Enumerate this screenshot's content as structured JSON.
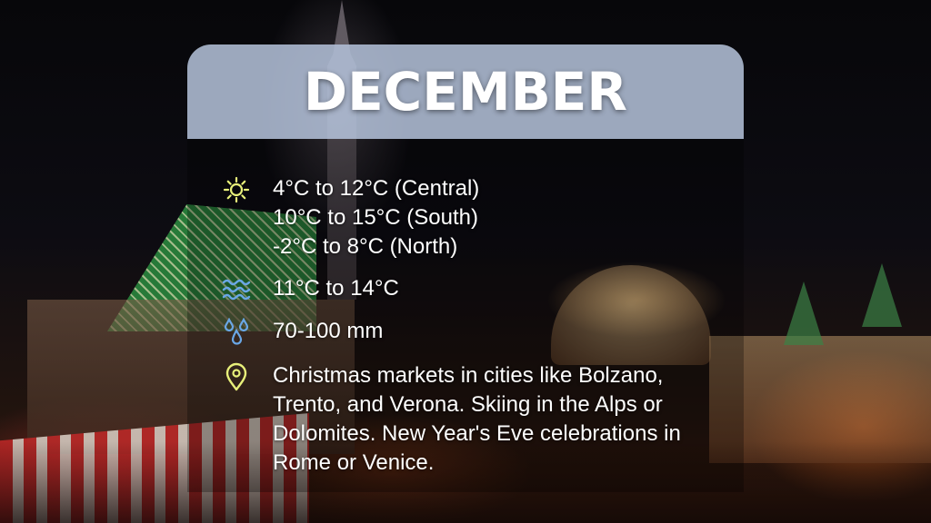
{
  "title": "DECEMBER",
  "colors": {
    "title_card": "#b0bed6",
    "icon_sun": "#e8f07a",
    "icon_waves": "#6aa7e6",
    "icon_drops": "#6aa7e6",
    "icon_pin": "#e8f07a"
  },
  "rows": {
    "air_temperature": {
      "icon": "sun-icon",
      "lines": "4°C to 12°C (Central)\n10°C to 15°C (South)\n-2°C to 8°C (North)"
    },
    "sea_temperature": {
      "icon": "waves-icon",
      "text": "11°C to 14°C"
    },
    "rainfall": {
      "icon": "raindrops-icon",
      "text": "70-100 mm"
    },
    "highlights": {
      "icon": "location-pin-icon",
      "text": "Christmas markets in cities like Bolzano, Trento, and Verona. Skiing in the Alps or Dolomites. New Year's Eve celebrations in Rome or Venice."
    }
  }
}
